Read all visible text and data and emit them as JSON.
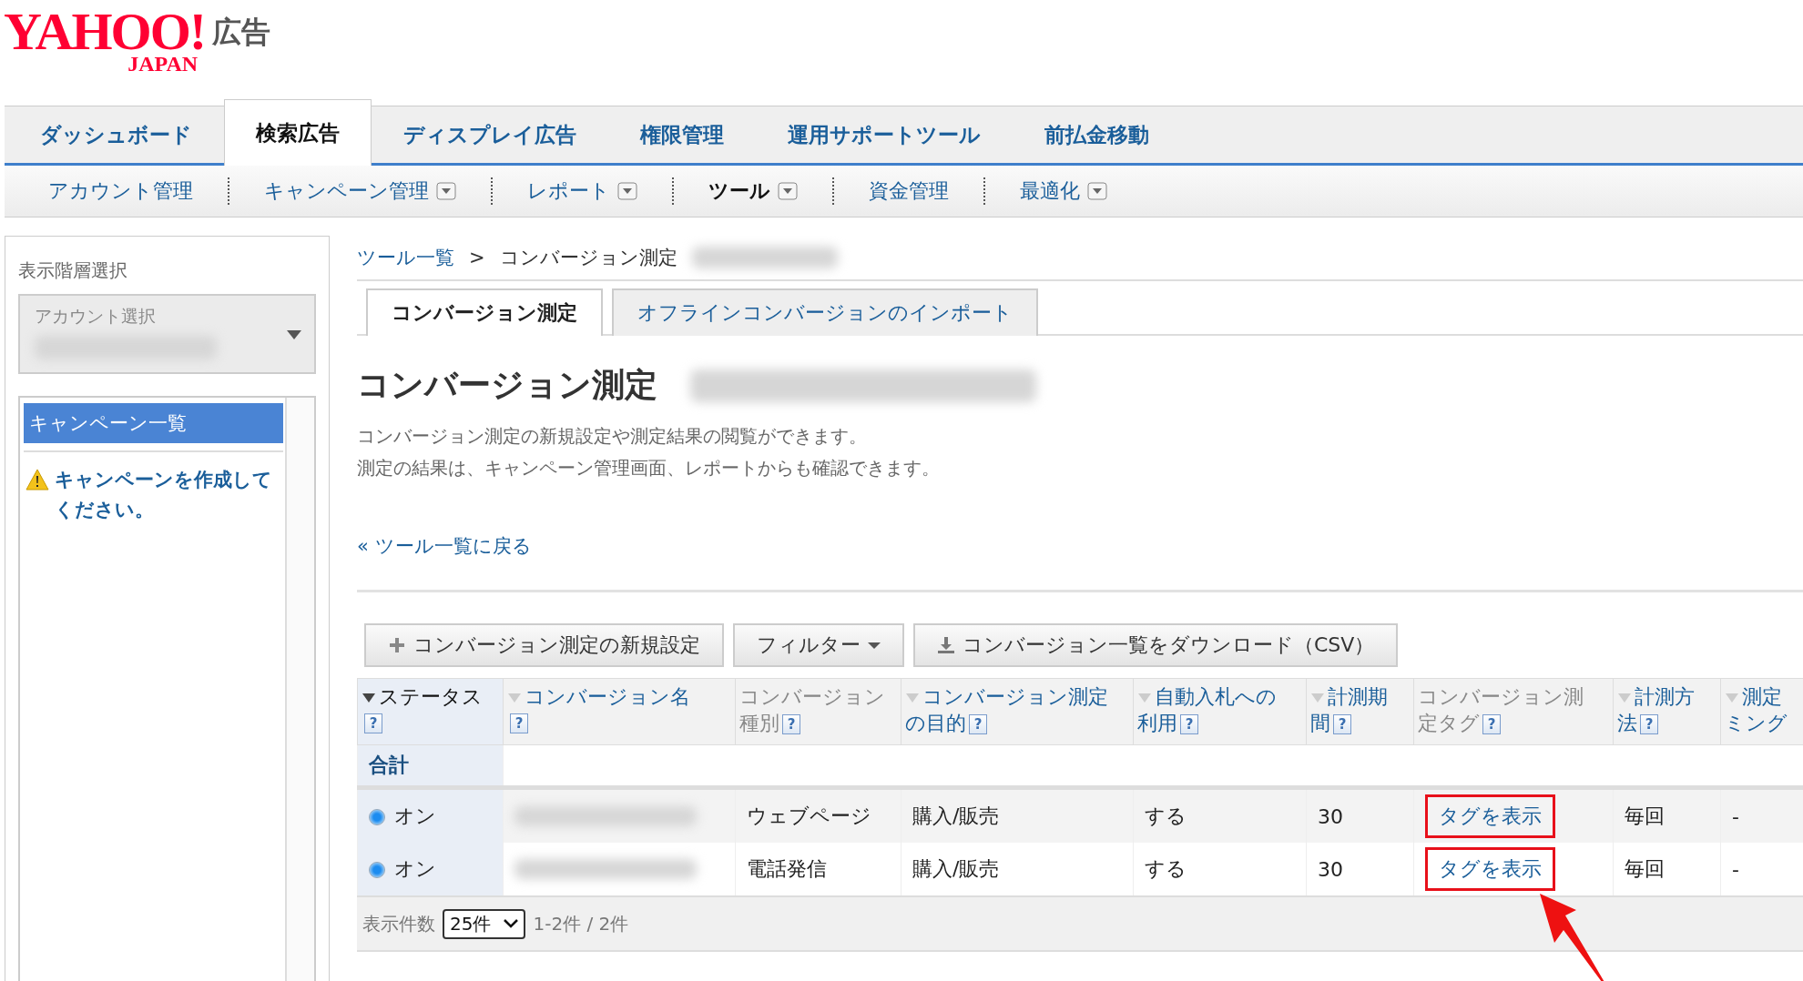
{
  "logo": {
    "brand": "YAHOO!",
    "region": "JAPAN",
    "product": "広告"
  },
  "main_nav": [
    {
      "label": "ダッシュボード",
      "selected": false
    },
    {
      "label": "検索広告",
      "selected": true
    },
    {
      "label": "ディスプレイ広告",
      "selected": false
    },
    {
      "label": "権限管理",
      "selected": false
    },
    {
      "label": "運用サポートツール",
      "selected": false
    },
    {
      "label": "前払金移動",
      "selected": false
    }
  ],
  "sub_nav": [
    {
      "label": "アカウント管理",
      "dropdown": false,
      "selected": false
    },
    {
      "label": "キャンペーン管理",
      "dropdown": true,
      "selected": false
    },
    {
      "label": "レポート",
      "dropdown": true,
      "selected": false
    },
    {
      "label": "ツール",
      "dropdown": true,
      "selected": true
    },
    {
      "label": "資金管理",
      "dropdown": false,
      "selected": false
    },
    {
      "label": "最適化",
      "dropdown": true,
      "selected": false
    }
  ],
  "sidebar": {
    "title": "表示階層選択",
    "account_select": {
      "placeholder": "アカウント選択"
    },
    "items": [
      {
        "kind": "header",
        "label": "キャンペーン一覧"
      },
      {
        "kind": "warning",
        "label": "キャンペーンを作成してください。"
      }
    ]
  },
  "breadcrumb": {
    "items": [
      {
        "kind": "link",
        "label": "ツール一覧"
      },
      {
        "kind": "current",
        "label": "コンバージョン測定"
      }
    ],
    "separator": ">"
  },
  "tabs": [
    {
      "label": "コンバージョン測定",
      "selected": true
    },
    {
      "label": "オフラインコンバージョンのインポート",
      "selected": false
    }
  ],
  "page_title": "コンバージョン測定",
  "description": [
    "コンバージョン測定の新規設定や測定結果の閲覧ができます。",
    "測定の結果は、キャンペーン管理画面、レポートからも確認できます。"
  ],
  "back_link": {
    "icon": "«",
    "label": "ツール一覧に戻る"
  },
  "toolbar": [
    {
      "kind": "add",
      "label": "コンバージョン測定の新規設定"
    },
    {
      "kind": "menu",
      "label": "フィルター"
    },
    {
      "kind": "download",
      "label": "コンバージョン一覧をダウンロード（CSV）"
    }
  ],
  "table": {
    "columns": [
      {
        "lines": [
          "ステータス"
        ],
        "sortable": true,
        "sorted": true,
        "help": "?"
      },
      {
        "lines": [
          "コンバージョン名"
        ],
        "sortable": true,
        "sorted": false,
        "help": "?"
      },
      {
        "lines": [
          "コンバージョン",
          "種別"
        ],
        "sortable": false,
        "sorted": false,
        "help": "?"
      },
      {
        "lines": [
          "コンバージョン測定",
          "の目的"
        ],
        "sortable": true,
        "sorted": false,
        "help": "?"
      },
      {
        "lines": [
          "自動入札への",
          "利用"
        ],
        "sortable": true,
        "sorted": false,
        "help": "?"
      },
      {
        "lines": [
          "計測期",
          "間"
        ],
        "sortable": true,
        "sorted": false,
        "help": "?"
      },
      {
        "lines": [
          "コンバージョン測",
          "定タグ"
        ],
        "sortable": false,
        "sorted": false,
        "help": "?"
      },
      {
        "lines": [
          "計測方",
          "法"
        ],
        "sortable": true,
        "sorted": false,
        "help": "?"
      },
      {
        "lines": [
          "測定",
          "ミング"
        ],
        "sortable": true,
        "sorted": false
      }
    ],
    "total_label": "合計",
    "rows": [
      {
        "status": "オン",
        "on": true,
        "type": "ウェブページ",
        "purpose": "購入/販売",
        "auto_bidding": "する",
        "period": "30",
        "tag_link": "タグを表示",
        "highlighted": true,
        "method": "毎回",
        "timing": "-"
      },
      {
        "status": "オン",
        "on": true,
        "type": "電話発信",
        "purpose": "購入/販売",
        "auto_bidding": "する",
        "period": "30",
        "tag_link": "タグを表示",
        "highlighted": true,
        "method": "毎回",
        "timing": "-"
      }
    ]
  },
  "pagination": {
    "label": "表示件数",
    "page_size": "25件",
    "range": "1-2件 / 2件"
  }
}
